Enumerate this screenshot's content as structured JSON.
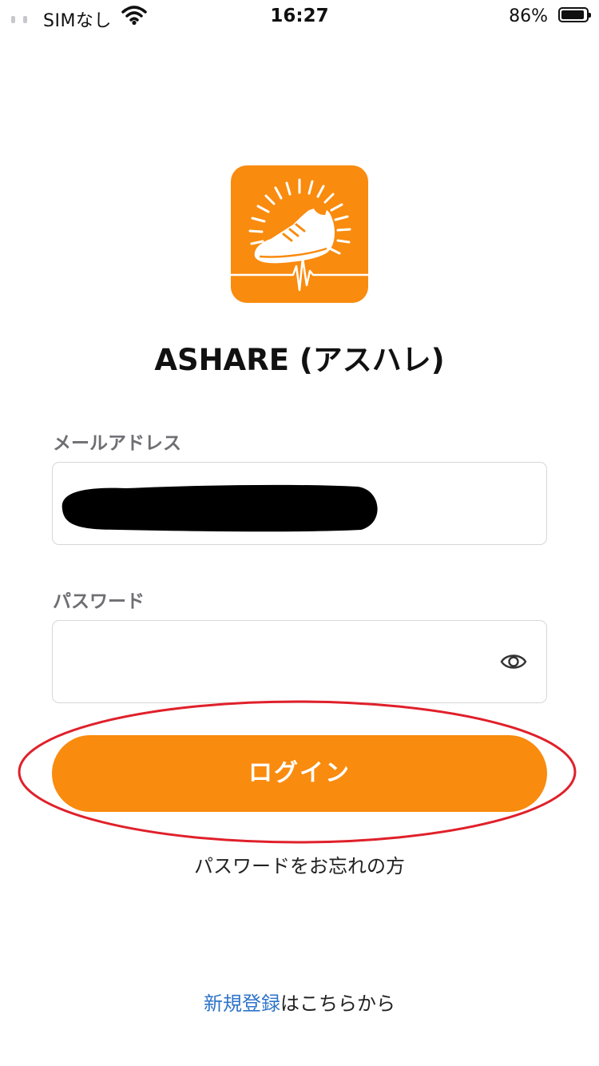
{
  "status_bar": {
    "carrier": "SIMなし",
    "time": "16:27",
    "battery": "86%",
    "icons": [
      "signal-icon",
      "wifi-icon",
      "battery-icon"
    ]
  },
  "app": {
    "name": "ASHARE (アスハレ)",
    "logo_icon": "running-shoe-sunburst-icon"
  },
  "email": {
    "label": "メールアドレス",
    "value": ""
  },
  "password": {
    "label": "パスワード",
    "value": "",
    "toggle_icon": "eye-icon"
  },
  "login": {
    "label": "ログイン"
  },
  "forgot_password": {
    "label": "パスワードをお忘れの方"
  },
  "signup": {
    "link_label": "新規登録",
    "suffix": "はこちらから"
  },
  "colors": {
    "accent": "#f98b0e",
    "link": "#2f74c9",
    "annotation": "#e0202a"
  }
}
